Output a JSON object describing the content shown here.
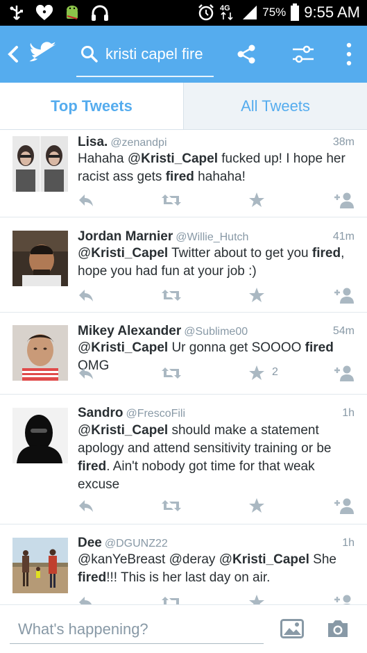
{
  "status_bar": {
    "network": "4G",
    "battery": "75%",
    "time": "9:55 AM"
  },
  "app_bar": {
    "search_query": "kristi capel fire"
  },
  "tabs": [
    {
      "label": "Top Tweets",
      "selected": true
    },
    {
      "label": "All Tweets",
      "selected": false
    }
  ],
  "tweets": [
    {
      "name": "Lisa.",
      "handle": "@zenandpi",
      "time": "38m",
      "segments": [
        {
          "t": "Hahaha @",
          "b": false
        },
        {
          "t": "Kristi_Capel",
          "b": true
        },
        {
          "t": " fucked up! I hope her racist ass gets ",
          "b": false
        },
        {
          "t": "fired",
          "b": true
        },
        {
          "t": " hahaha!",
          "b": false
        }
      ],
      "favorites": ""
    },
    {
      "name": "Jordan Marnier",
      "handle": "@Willie_Hutch",
      "time": "41m",
      "segments": [
        {
          "t": "@",
          "b": false
        },
        {
          "t": "Kristi_Capel",
          "b": true
        },
        {
          "t": " Twitter about to get you ",
          "b": false
        },
        {
          "t": "fired",
          "b": true
        },
        {
          "t": ", hope you had fun at your job :)",
          "b": false
        }
      ],
      "favorites": ""
    },
    {
      "name": "Mikey Alexander",
      "handle": "@Sublime00",
      "time": "54m",
      "segments": [
        {
          "t": "@",
          "b": false
        },
        {
          "t": "Kristi_Capel",
          "b": true
        },
        {
          "t": " Ur gonna get SOOOO ",
          "b": false
        },
        {
          "t": "fired",
          "b": true
        },
        {
          "t": " OMG",
          "b": false
        }
      ],
      "favorites": "2"
    },
    {
      "name": "Sandro",
      "handle": "@FrescoFili",
      "time": "1h",
      "segments": [
        {
          "t": "@",
          "b": false
        },
        {
          "t": "Kristi_Capel",
          "b": true
        },
        {
          "t": " should make a statement apology and attend sensitivity training or be ",
          "b": false
        },
        {
          "t": "fired",
          "b": true
        },
        {
          "t": ". Ain't nobody got time for that weak excuse",
          "b": false
        }
      ],
      "favorites": ""
    },
    {
      "name": "Dee",
      "handle": "@DGUNZ22",
      "time": "1h",
      "segments": [
        {
          "t": "@kanYeBreast @deray @",
          "b": false
        },
        {
          "t": "Kristi_Capel",
          "b": true
        },
        {
          "t": " She ",
          "b": false
        },
        {
          "t": "fired",
          "b": true
        },
        {
          "t": "!!! This is her last day on air.",
          "b": false
        }
      ],
      "favorites": ""
    }
  ],
  "compose": {
    "placeholder": "What's happening?"
  },
  "colors": {
    "brand": "#55acee",
    "action_gray": "#aab8c2",
    "text": "#292f33",
    "muted": "#8899a6"
  }
}
